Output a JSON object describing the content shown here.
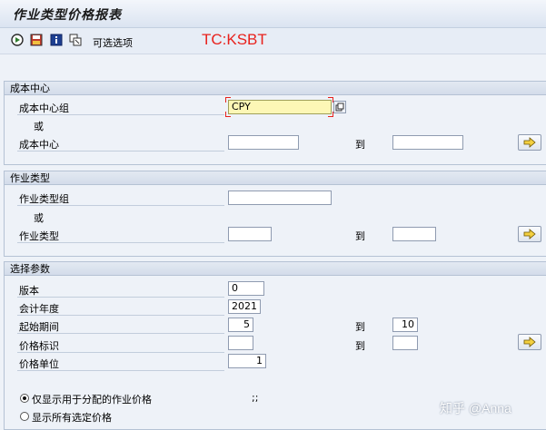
{
  "title": "作业类型价格报表",
  "toolbar": {
    "optional_label": "可选选项",
    "tcode": "TC:KSBT"
  },
  "cost_center": {
    "header": "成本中心",
    "group_label": "成本中心组",
    "group_value": "CPY",
    "or_label": "或",
    "single_label": "成本中心",
    "from_value": "",
    "to_label": "到",
    "to_value": ""
  },
  "activity_type": {
    "header": "作业类型",
    "group_label": "作业类型组",
    "group_value": "",
    "or_label": "或",
    "single_label": "作业类型",
    "from_value": "",
    "to_label": "到",
    "to_value": ""
  },
  "selection": {
    "header": "选择参数",
    "version_label": "版本",
    "version_value": "0",
    "fiscal_year_label": "会计年度",
    "fiscal_year_value": "2021",
    "start_period_label": "起始期间",
    "start_period_value": "5",
    "to_label_1": "到",
    "end_period_value": "10",
    "price_ind_label": "价格标识",
    "price_ind_value": "",
    "to_label_2": "到",
    "price_ind_to_value": "",
    "price_unit_label": "价格单位",
    "price_unit_value": "1",
    "radio_alloc_label": "仅显示用于分配的作业价格",
    "radio_alloc_suffix": ";;",
    "radio_all_label": "显示所有选定价格"
  },
  "watermark": "知乎 @Anna"
}
